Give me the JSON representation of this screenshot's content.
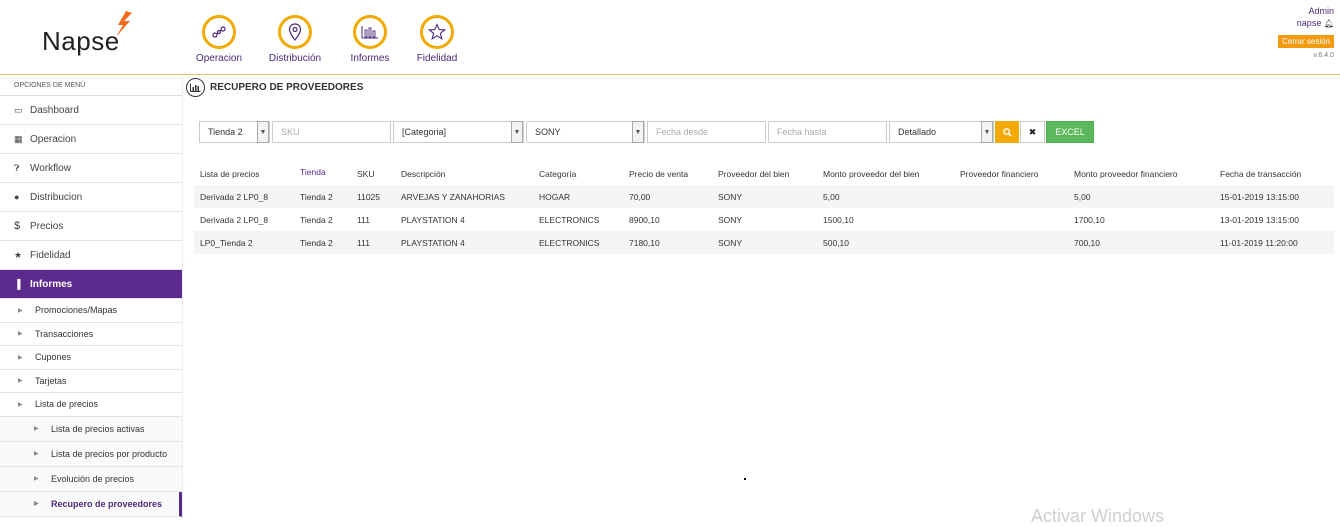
{
  "header": {
    "logo": "Napse",
    "nav": [
      {
        "label": "Operacion",
        "icon": "share-icon"
      },
      {
        "label": "Distribución",
        "icon": "map-pin-icon"
      },
      {
        "label": "Informes",
        "icon": "bar-chart-icon"
      },
      {
        "label": "Fidelidad",
        "icon": "star-icon"
      }
    ],
    "user": {
      "role": "Admin",
      "name": "napse",
      "logout": "Cerrar sesión",
      "version": "v.6.4.0"
    }
  },
  "sidebar": {
    "title": "OPCIONES DE MENÚ",
    "items": [
      {
        "label": "Dashboard",
        "icon": "laptop-icon"
      },
      {
        "label": "Operacion",
        "icon": "grid-icon"
      },
      {
        "label": "Workflow",
        "icon": "question-icon"
      },
      {
        "label": "Distribucion",
        "icon": "map-marker-icon"
      },
      {
        "label": "Precios",
        "icon": "dollar-icon"
      },
      {
        "label": "Fidelidad",
        "icon": "star-icon"
      },
      {
        "label": "Informes",
        "icon": "bar-chart-icon"
      }
    ],
    "sub_items": [
      "Promociones/Mapas",
      "Transacciones",
      "Cupones",
      "Tarjetas",
      "Lista de precios"
    ],
    "sub_sub_items": [
      "Lista de precios activas",
      "Lista de precios por producto",
      "Evolución de precios",
      "Recupero de proveedores"
    ]
  },
  "page": {
    "title": "RECUPERO DE PROVEEDORES"
  },
  "filters": {
    "tienda": "Tienda 2",
    "sku_placeholder": "SKU",
    "categoria": "[Categoria]",
    "proveedor": "SONY",
    "fecha_desde_placeholder": "Fecha desde",
    "fecha_hasta_placeholder": "Fecha hasta",
    "modo": "Detallado",
    "excel_label": "EXCEL"
  },
  "table": {
    "headers": [
      "Lista de precios",
      "Tienda",
      "SKU",
      "Descripción",
      "Categoría",
      "Precio de venta",
      "Proveedor del bien",
      "Monto proveedor del bien",
      "Proveedor financiero",
      "Monto proveedor financiero",
      "Fecha de transacción"
    ],
    "rows": [
      [
        "Derivada 2 LP0_8",
        "Tienda 2",
        "11025",
        "ARVEJAS Y ZANAHORIAS",
        "HOGAR",
        "70,00",
        "SONY",
        "5,00",
        "",
        "5,00",
        "15-01-2019 13:15:00"
      ],
      [
        "Derivada 2 LP0_8",
        "Tienda 2",
        "111",
        "PLAYSTATION 4",
        "ELECTRONICS",
        "8900,10",
        "SONY",
        "1500,10",
        "",
        "1700,10",
        "13-01-2019 13:15:00"
      ],
      [
        "LP0_Tienda 2",
        "Tienda 2",
        "111",
        "PLAYSTATION 4",
        "ELECTRONICS",
        "7180,10",
        "SONY",
        "500,10",
        "",
        "700,10",
        "11-01-2019 11:20:00"
      ]
    ]
  },
  "watermark": "Activar Windows",
  "colors": {
    "accent": "#f2a900",
    "brand": "#5b2a8c",
    "excel": "#5cb85c"
  }
}
